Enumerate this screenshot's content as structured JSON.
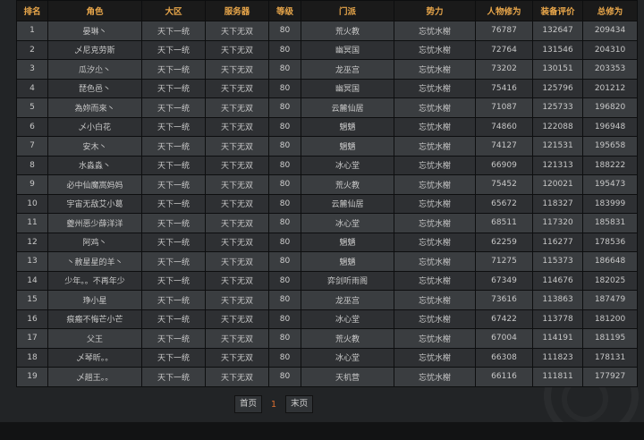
{
  "table": {
    "headers": {
      "rank": "排名",
      "role": "角色",
      "region": "大区",
      "server": "服务器",
      "level": "等级",
      "sect": "门派",
      "faction": "势力",
      "char_power": "人物修为",
      "equip_score": "装备评价",
      "total_power": "总修为"
    },
    "rows": [
      {
        "rank": "1",
        "role": "晏琳丶",
        "region": "天下一统",
        "server": "天下无双",
        "level": "80",
        "sect": "荒火教",
        "faction": "忘忧水榭",
        "char_power": "76787",
        "equip_score": "132647",
        "total_power": "209434"
      },
      {
        "rank": "2",
        "role": "乄尼克劳斯",
        "region": "天下一统",
        "server": "天下无双",
        "level": "80",
        "sect": "幽冥国",
        "faction": "忘忧水榭",
        "char_power": "72764",
        "equip_score": "131546",
        "total_power": "204310"
      },
      {
        "rank": "3",
        "role": "瓜汐尐丶",
        "region": "天下一统",
        "server": "天下无双",
        "level": "80",
        "sect": "龙巫宫",
        "faction": "忘忧水榭",
        "char_power": "73202",
        "equip_score": "130151",
        "total_power": "203353"
      },
      {
        "rank": "4",
        "role": "琵色邑丶",
        "region": "天下一统",
        "server": "天下无双",
        "level": "80",
        "sect": "幽冥国",
        "faction": "忘忧水榭",
        "char_power": "75416",
        "equip_score": "125796",
        "total_power": "201212"
      },
      {
        "rank": "5",
        "role": "為妳而來丶",
        "region": "天下一统",
        "server": "天下无双",
        "level": "80",
        "sect": "云麓仙居",
        "faction": "忘忧水榭",
        "char_power": "71087",
        "equip_score": "125733",
        "total_power": "196820"
      },
      {
        "rank": "6",
        "role": "乄小白花",
        "region": "天下一统",
        "server": "天下无双",
        "level": "80",
        "sect": "魍魉",
        "faction": "忘忧水榭",
        "char_power": "74860",
        "equip_score": "122088",
        "total_power": "196948"
      },
      {
        "rank": "7",
        "role": "安木丶",
        "region": "天下一统",
        "server": "天下无双",
        "level": "80",
        "sect": "魍魉",
        "faction": "忘忧水榭",
        "char_power": "74127",
        "equip_score": "121531",
        "total_power": "195658"
      },
      {
        "rank": "8",
        "role": "水淼淼丶",
        "region": "天下一统",
        "server": "天下无双",
        "level": "80",
        "sect": "冰心堂",
        "faction": "忘忧水榭",
        "char_power": "66909",
        "equip_score": "121313",
        "total_power": "188222"
      },
      {
        "rank": "9",
        "role": "必中仙魔嵩妈妈",
        "region": "天下一统",
        "server": "天下无双",
        "level": "80",
        "sect": "荒火教",
        "faction": "忘忧水榭",
        "char_power": "75452",
        "equip_score": "120021",
        "total_power": "195473"
      },
      {
        "rank": "10",
        "role": "宇宙无敌艾小葛",
        "region": "天下一统",
        "server": "天下无双",
        "level": "80",
        "sect": "云麓仙居",
        "faction": "忘忧水榭",
        "char_power": "65672",
        "equip_score": "118327",
        "total_power": "183999"
      },
      {
        "rank": "11",
        "role": "夔州恶少薛洋洋",
        "region": "天下一统",
        "server": "天下无双",
        "level": "80",
        "sect": "冰心堂",
        "faction": "忘忧水榭",
        "char_power": "68511",
        "equip_score": "117320",
        "total_power": "185831"
      },
      {
        "rank": "12",
        "role": "阿鸡丶",
        "region": "天下一统",
        "server": "天下无双",
        "level": "80",
        "sect": "魍魉",
        "faction": "忘忧水榭",
        "char_power": "62259",
        "equip_score": "116277",
        "total_power": "178536"
      },
      {
        "rank": "13",
        "role": "丶赦星星的羊丶",
        "region": "天下一统",
        "server": "天下无双",
        "level": "80",
        "sect": "魍魉",
        "faction": "忘忧水榭",
        "char_power": "71275",
        "equip_score": "115373",
        "total_power": "186648"
      },
      {
        "rank": "14",
        "role": "少年。。不再年少",
        "region": "天下一统",
        "server": "天下无双",
        "level": "80",
        "sect": "弈剑听雨阁",
        "faction": "忘忧水榭",
        "char_power": "67349",
        "equip_score": "114676",
        "total_power": "182025"
      },
      {
        "rank": "15",
        "role": "琤小星",
        "region": "天下一统",
        "server": "天下无双",
        "level": "80",
        "sect": "龙巫宫",
        "faction": "忘忧水榭",
        "char_power": "73616",
        "equip_score": "113863",
        "total_power": "187479"
      },
      {
        "rank": "16",
        "role": "痕瘢不悔芒小芒",
        "region": "天下一统",
        "server": "天下无双",
        "level": "80",
        "sect": "冰心堂",
        "faction": "忘忧水榭",
        "char_power": "67422",
        "equip_score": "113778",
        "total_power": "181200"
      },
      {
        "rank": "17",
        "role": "父王",
        "region": "天下一统",
        "server": "天下无双",
        "level": "80",
        "sect": "荒火教",
        "faction": "忘忧水榭",
        "char_power": "67004",
        "equip_score": "114191",
        "total_power": "181195"
      },
      {
        "rank": "18",
        "role": "乄琴昕。。",
        "region": "天下一统",
        "server": "天下无双",
        "level": "80",
        "sect": "冰心堂",
        "faction": "忘忧水榭",
        "char_power": "66308",
        "equip_score": "111823",
        "total_power": "178131"
      },
      {
        "rank": "19",
        "role": "乄趟王。。",
        "region": "天下一统",
        "server": "天下无双",
        "level": "80",
        "sect": "天机营",
        "faction": "忘忧水榭",
        "char_power": "66116",
        "equip_score": "111811",
        "total_power": "177927"
      }
    ]
  },
  "pagination": {
    "first_label": "首页",
    "current_page": "1",
    "last_label": "末页"
  },
  "colors": {
    "header_text": "#e8a64a",
    "current_page": "#e07030"
  }
}
